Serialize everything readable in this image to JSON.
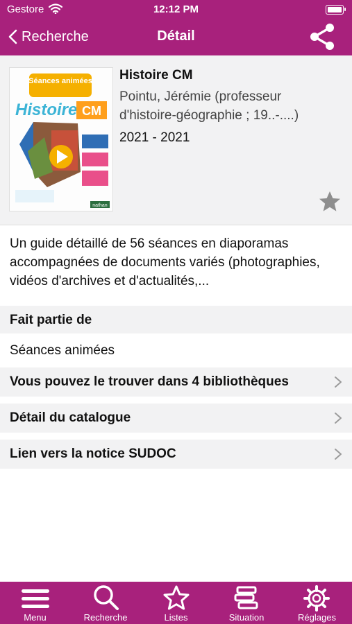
{
  "status_bar": {
    "carrier": "Gestore",
    "time": "12:12 PM"
  },
  "nav": {
    "back_label": "Recherche",
    "title": "Détail"
  },
  "book": {
    "cover_series_text": "Séances animées",
    "cover_title_text": "Histoire",
    "cover_level_text": "CM",
    "cover_publisher_text": "nathan",
    "title": "Histoire CM",
    "author": "Pointu, Jérémie (professeur d'histoire-géographie ; 19..-....)",
    "years": "2021 - 2021"
  },
  "summary": "Un guide détaillé de 56 séances en diaporamas accompagnées de documents variés (photographies, vidéos d'archives et d'actualités,...",
  "sections": {
    "part_of_header": "Fait partie de",
    "part_of_value": "Séances animées",
    "libraries": "Vous pouvez le trouver dans 4 bibliothèques",
    "catalog": "Détail du catalogue",
    "sudoc": "Lien vers la notice SUDOC"
  },
  "tabbar": [
    {
      "label": "Menu",
      "icon": "menu-icon"
    },
    {
      "label": "Recherche",
      "icon": "search-icon"
    },
    {
      "label": "Listes",
      "icon": "star-icon"
    },
    {
      "label": "Situation",
      "icon": "books-icon"
    },
    {
      "label": "Réglages",
      "icon": "gear-icon"
    }
  ],
  "colors": {
    "brand": "#a8217c",
    "section_bg": "#f2f2f3",
    "star_gray": "#8e8e8e"
  }
}
